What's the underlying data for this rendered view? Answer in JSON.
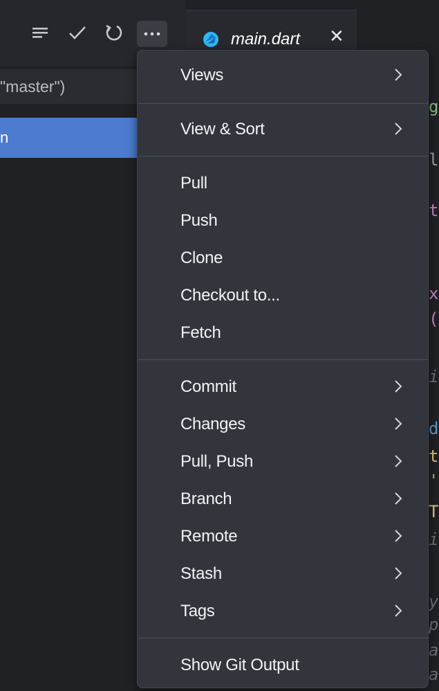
{
  "toolbar": {
    "icons": [
      "list-icon",
      "check-icon",
      "refresh-icon",
      "more-icon"
    ],
    "more_label": "···"
  },
  "tab": {
    "title": "main.dart",
    "close": "✕",
    "icon": "dart-icon",
    "icon_color": "#2fb6f6"
  },
  "left_pane": {
    "branch_text": "\"master\")",
    "selected_text": "n",
    "selection_color": "#4c7bd0"
  },
  "editor": {
    "fragments": [
      {
        "text": "g",
        "color": "#7ec27e"
      },
      {
        "text": "le",
        "color": "#9aa0a6"
      },
      {
        "text": "t",
        "color": "#c586c0"
      },
      {
        "text": "x",
        "color": "#c586c0"
      },
      {
        "text": "(",
        "color": "#c586c0"
      },
      {
        "text": "i",
        "color": "#6b6f77"
      },
      {
        "text": "d",
        "color": "#569cd6"
      },
      {
        "text": "t",
        "color": "#e5c07b"
      },
      {
        "text": "'",
        "color": "#98c379"
      },
      {
        "text": "T",
        "color": "#e5c07b"
      },
      {
        "text": "i",
        "color": "#6b6f77"
      },
      {
        "text": "y",
        "color": "#6b6f77"
      },
      {
        "text": "p",
        "color": "#6b6f77"
      },
      {
        "text": "a",
        "color": "#6b6f77"
      },
      {
        "text": "a",
        "color": "#6b6f77"
      }
    ]
  },
  "menu": {
    "groups": [
      [
        {
          "label": "Views",
          "submenu": true
        }
      ],
      [
        {
          "label": "View & Sort",
          "submenu": true
        }
      ],
      [
        {
          "label": "Pull",
          "submenu": false
        },
        {
          "label": "Push",
          "submenu": false
        },
        {
          "label": "Clone",
          "submenu": false
        },
        {
          "label": "Checkout to...",
          "submenu": false
        },
        {
          "label": "Fetch",
          "submenu": false
        }
      ],
      [
        {
          "label": "Commit",
          "submenu": true
        },
        {
          "label": "Changes",
          "submenu": true
        },
        {
          "label": "Pull, Push",
          "submenu": true
        },
        {
          "label": "Branch",
          "submenu": true
        },
        {
          "label": "Remote",
          "submenu": true
        },
        {
          "label": "Stash",
          "submenu": true
        },
        {
          "label": "Tags",
          "submenu": true
        }
      ],
      [
        {
          "label": "Show Git Output",
          "submenu": false
        }
      ]
    ]
  }
}
